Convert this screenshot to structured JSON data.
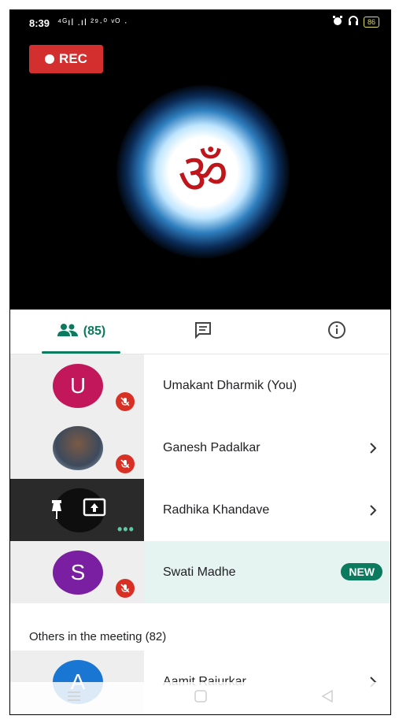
{
  "status_bar": {
    "time": "8:39",
    "signal_text": "⁴ᴳıl .ıl ²⁹·⁰ ᵛᴼ ·",
    "battery": "86"
  },
  "recording": {
    "label": "REC"
  },
  "video": {
    "symbol": "ॐ",
    "symbol_color": "#c0161b"
  },
  "tabs": {
    "people_count": "(85)",
    "active_color": "#0b7a5f"
  },
  "participants": [
    {
      "initial": "U",
      "name": "Umakant Dharmik (You)",
      "avatar_color": "#c2185b",
      "muted": true
    },
    {
      "initial": "",
      "name": "Ganesh Padalkar",
      "muted": true
    },
    {
      "initial": "",
      "name": "Radhika Khandave",
      "muted": false
    },
    {
      "initial": "S",
      "name": "Swati Madhe",
      "avatar_color": "#7b1fa2",
      "muted": true,
      "badge": "NEW"
    },
    {
      "initial": "A",
      "name": "Aamit Raiurkar",
      "avatar_color": "#1976d2"
    }
  ],
  "others_section": {
    "title": "Others in the meeting (82)"
  }
}
